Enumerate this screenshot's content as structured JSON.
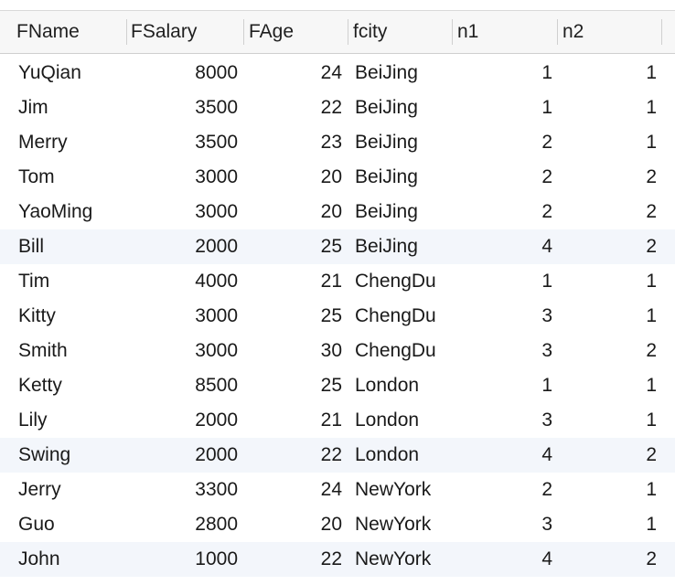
{
  "table": {
    "columns": [
      "FName",
      "FSalary",
      "FAge",
      "fcity",
      "n1",
      "n2"
    ],
    "rows": [
      [
        "YuQian",
        "8000",
        "24",
        "BeiJing",
        "1",
        "1"
      ],
      [
        "Jim",
        "3500",
        "22",
        "BeiJing",
        "1",
        "1"
      ],
      [
        "Merry",
        "3500",
        "23",
        "BeiJing",
        "2",
        "1"
      ],
      [
        "Tom",
        "3000",
        "20",
        "BeiJing",
        "2",
        "2"
      ],
      [
        "YaoMing",
        "3000",
        "20",
        "BeiJing",
        "2",
        "2"
      ],
      [
        "Bill",
        "2000",
        "25",
        "BeiJing",
        "4",
        "2"
      ],
      [
        "Tim",
        "4000",
        "21",
        "ChengDu",
        "1",
        "1"
      ],
      [
        "Kitty",
        "3000",
        "25",
        "ChengDu",
        "3",
        "1"
      ],
      [
        "Smith",
        "3000",
        "30",
        "ChengDu",
        "3",
        "2"
      ],
      [
        "Ketty",
        "8500",
        "25",
        "London",
        "1",
        "1"
      ],
      [
        "Lily",
        "2000",
        "21",
        "London",
        "3",
        "1"
      ],
      [
        "Swing",
        "2000",
        "22",
        "London",
        "4",
        "2"
      ],
      [
        "Jerry",
        "3300",
        "24",
        "NewYork",
        "2",
        "1"
      ],
      [
        "Guo",
        "2800",
        "20",
        "NewYork",
        "3",
        "1"
      ],
      [
        "John",
        "1000",
        "22",
        "NewYork",
        "4",
        "2"
      ]
    ]
  },
  "colors": {
    "header_bg": "#f7f7f7",
    "alt_row_bg": "#f3f6fb",
    "text": "#1a1a1a"
  }
}
